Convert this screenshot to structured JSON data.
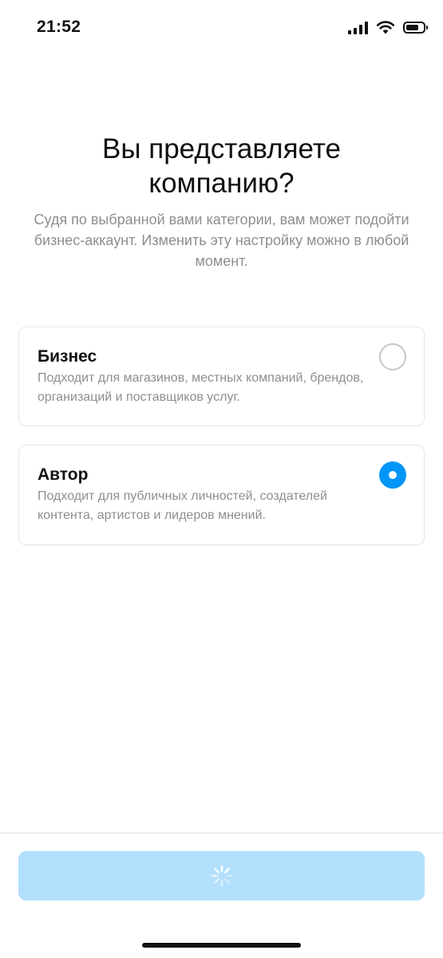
{
  "status_bar": {
    "time": "21:52",
    "signal_icon": "cellular-signal-icon",
    "wifi_icon": "wifi-icon",
    "battery_icon": "battery-icon",
    "battery_level": 0.75
  },
  "header": {
    "title": "Вы представляете компанию?",
    "subtitle": "Судя по выбранной вами категории, вам может подойти бизнес-аккаунт. Изменить эту настройку можно в любой момент."
  },
  "options": [
    {
      "title": "Бизнес",
      "description": "Подходит для магазинов, местных компаний, брендов, организаций и поставщиков услуг.",
      "selected": false
    },
    {
      "title": "Автор",
      "description": "Подходит для публичных личностей, создателей контента, артистов и лидеров мнений.",
      "selected": true
    }
  ],
  "footer": {
    "button_icon": "loading-spinner-icon",
    "button_state": "loading"
  },
  "colors": {
    "accent": "#0095f6",
    "button_disabled": "#b2dffc",
    "secondary_text": "#8e8e8e",
    "border": "#e5e5e5"
  }
}
